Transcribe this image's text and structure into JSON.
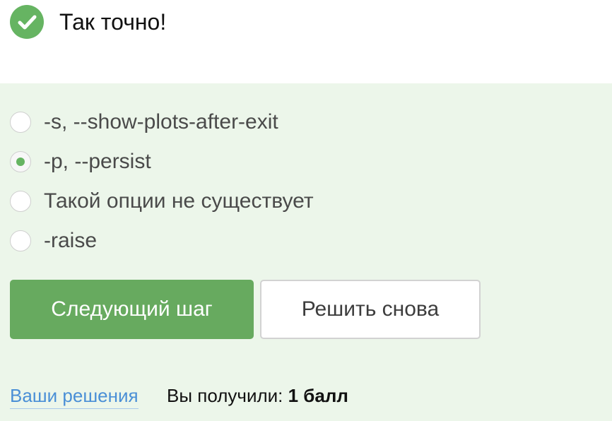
{
  "status": {
    "icon": "checkmark-icon",
    "text": "Так точно!",
    "color": "#66b462"
  },
  "quiz": {
    "options": [
      {
        "label": "-s, --show-plots-after-exit",
        "selected": false
      },
      {
        "label": "-p, --persist",
        "selected": true
      },
      {
        "label": "Такой опции не существует",
        "selected": false
      },
      {
        "label": "-raise",
        "selected": false
      }
    ]
  },
  "buttons": {
    "next_label": "Следующий шаг",
    "retry_label": "Решить снова"
  },
  "footer": {
    "solutions_link": "Ваши решения",
    "score_prefix": "Вы получили:",
    "score_value": "1 балл"
  },
  "colors": {
    "accent": "#67aa5f",
    "panel_bg": "#ecf6ea",
    "link": "#4a8fd6"
  }
}
